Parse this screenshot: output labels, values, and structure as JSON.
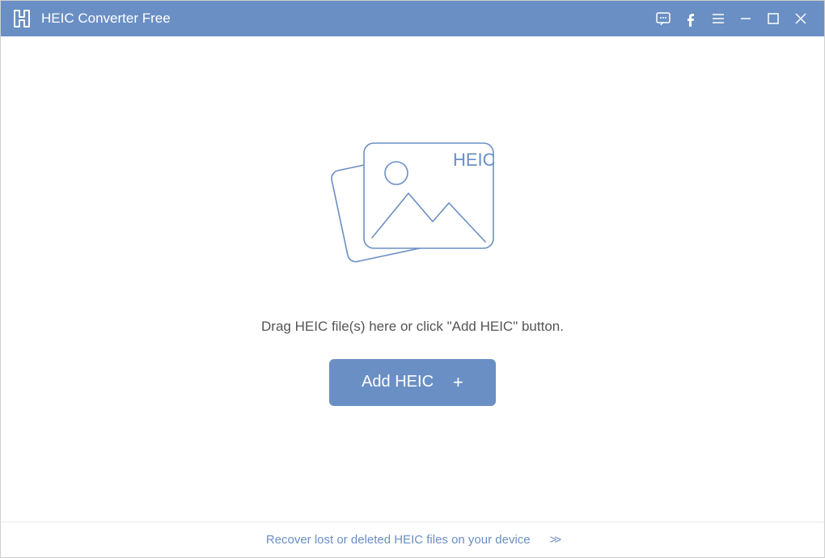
{
  "app": {
    "title": "HEIC Converter Free"
  },
  "dropzone": {
    "badge": "HEIC",
    "instruction": "Drag HEIC file(s) here or click \"Add HEIC\" button."
  },
  "buttons": {
    "add_label": "Add HEIC"
  },
  "footer": {
    "recover_text": "Recover lost or deleted HEIC files on your device"
  }
}
